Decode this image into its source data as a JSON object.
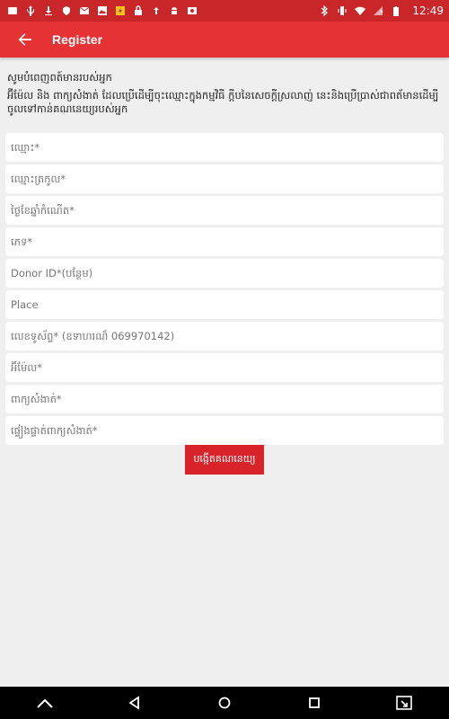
{
  "status_bar": {
    "time": "12:49",
    "left_icons": [
      "image-icon",
      "usb-icon",
      "download-icon",
      "shield-icon",
      "gmail-icon",
      "photo-icon",
      "lightning-icon",
      "lock-icon",
      "upload-icon",
      "android-icon",
      "photo-icon-2"
    ],
    "right_icons": [
      "bluetooth-icon",
      "vibrate-icon",
      "wifi-icon",
      "no-sim-icon",
      "battery-icon"
    ]
  },
  "toolbar": {
    "title": "Register",
    "background": "#e53235"
  },
  "form": {
    "heading": "សូមបំពេញពត៍មានរបស់អ្នក",
    "description": "អ៊ីម៉ែល និង ពាក្យសំងាត់ ដែលប្រើដើម្បីចុះឈ្មោះក្នុងកម្មវិធី ក្ដីបនៃសេចក្ដីស្រលាញ់ នេះនិងប្រើប្រាស់ជាពត័មានដើម្បីចូលទៅកាន់គណនេយ្យរបស់អ្នក",
    "fields": [
      {
        "placeholder": "ឈ្មោះ*"
      },
      {
        "placeholder": "ឈ្មោះត្រកូល*"
      },
      {
        "placeholder": "ថ្ងៃខែឆ្នាំកំណើត*"
      },
      {
        "placeholder": "ភេទ*"
      },
      {
        "placeholder": "Donor ID*(បន្ថែម)"
      },
      {
        "placeholder": "Place"
      },
      {
        "placeholder": "លេខទូស័ព្ទ* (ឧទាហរណ៏ 069970142)"
      },
      {
        "placeholder": "អ៊ីម៉ែល*"
      },
      {
        "placeholder": "ពាក្យសំងាត់*"
      },
      {
        "placeholder": "ផ្ទៀងផ្ទាត់ពាក្យសំងាត់*"
      }
    ],
    "submit_label": "បង្កើតគណនេយ្យ"
  },
  "colors": {
    "status_bar": "#c9262a",
    "accent": "#e53235",
    "button": "#d9232a",
    "background": "#efefef"
  }
}
